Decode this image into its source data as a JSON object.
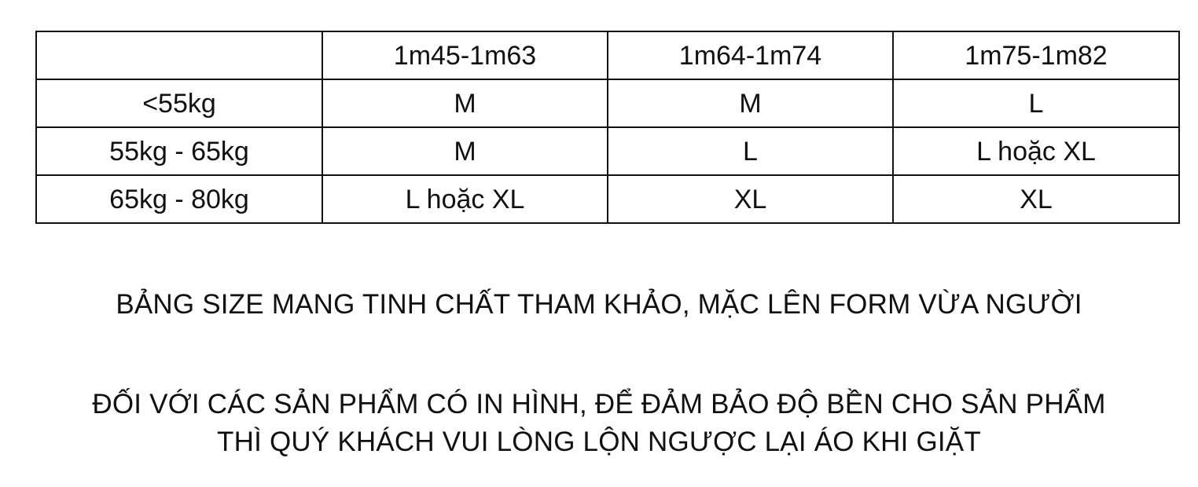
{
  "size_table": {
    "header": [
      "",
      "1m45-1m63",
      "1m64-1m74",
      "1m75-1m82"
    ],
    "rows": [
      [
        "<55kg",
        "M",
        "M",
        "L"
      ],
      [
        "55kg - 65kg",
        "M",
        "L",
        "L hoặc XL"
      ],
      [
        "65kg - 80kg",
        "L hoặc XL",
        "XL",
        "XL"
      ]
    ]
  },
  "notes": {
    "reference": "BẢNG SIZE MANG TINH CHẤT THAM KHẢO, MẶC LÊN FORM VỪA NGƯỜI",
    "care_line_1": "ĐỐI VỚI CÁC SẢN PHẨM CÓ IN HÌNH, ĐỂ ĐẢM BẢO ĐỘ BỀN CHO SẢN PHẨM",
    "care_line_2": "THÌ QUÝ KHÁCH VUI LÒNG LỘN NGƯỢC LẠI ÁO KHI GIẶT"
  }
}
